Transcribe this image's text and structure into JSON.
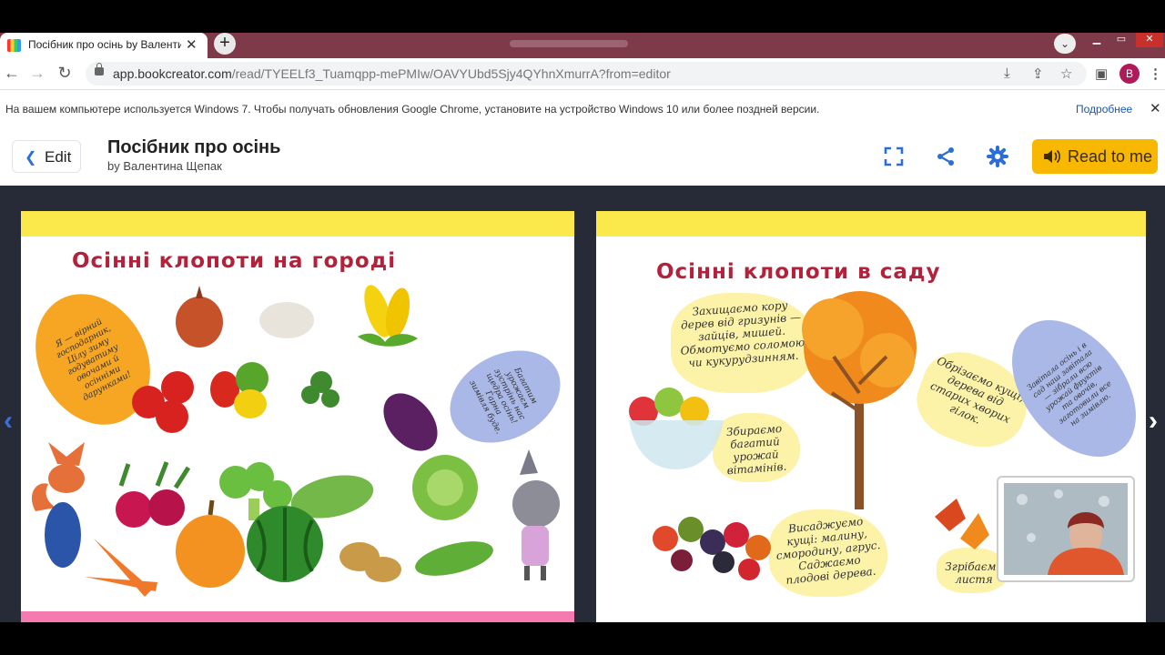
{
  "browser": {
    "tab_title": "Посібник про осінь by Валенти",
    "tab_close": "✕",
    "new_tab": "+",
    "url_host": "app.bookcreator.com",
    "url_path": "/read/TYEELf3_Tuamqpp-mePMIw/OAVYUbd5Sjy4QYhnXmurrA?from=editor",
    "profile_initial": "B"
  },
  "infobar": {
    "message": "На вашем компьютере используется Windows 7. Чтобы получать обновления Google Chrome, установите на устройство Windows 10 или более поздней версии.",
    "more_link": "Подробнее",
    "close": "✕"
  },
  "appbar": {
    "edit_label": "Edit",
    "book_title": "Посібник про осінь",
    "author": "by Валентина Щепак",
    "read_label": "Read to me",
    "accent": "#f8b800",
    "icon_color": "#2b6fd6"
  },
  "book": {
    "left_page": {
      "title": "Осінні клопоти на городі",
      "bubble_orange": "Я — вірний господарник, Цілу зиму годуватиму овочами й осінніми дарунками!",
      "bubble_blue": "Багатим урожаєм зустрінь нас щедра осінь! Гарна зимівля буде."
    },
    "right_page": {
      "title": "Осінні клопоти в саду",
      "note_protect": "Захищаємо кору дерев від гризунів — зайців, мишей. Обмотуємо соломою чи кукурудзинням.",
      "note_harvest": "Збираємо багатий урожай вітамінів.",
      "note_plant": "Висаджуємо кущі: малину, смородину, агрус. Саджаємо плодові дерева.",
      "note_trim": "Обрізаємо кущі, дерева від старих хворих гілок.",
      "note_leaves": "Згрібаємо листя",
      "bubble_blue": "Завітала осінь і в сад наш завітала — зібрали всю урожай фруктів та овочів, заготовили все на зимівлю."
    }
  }
}
